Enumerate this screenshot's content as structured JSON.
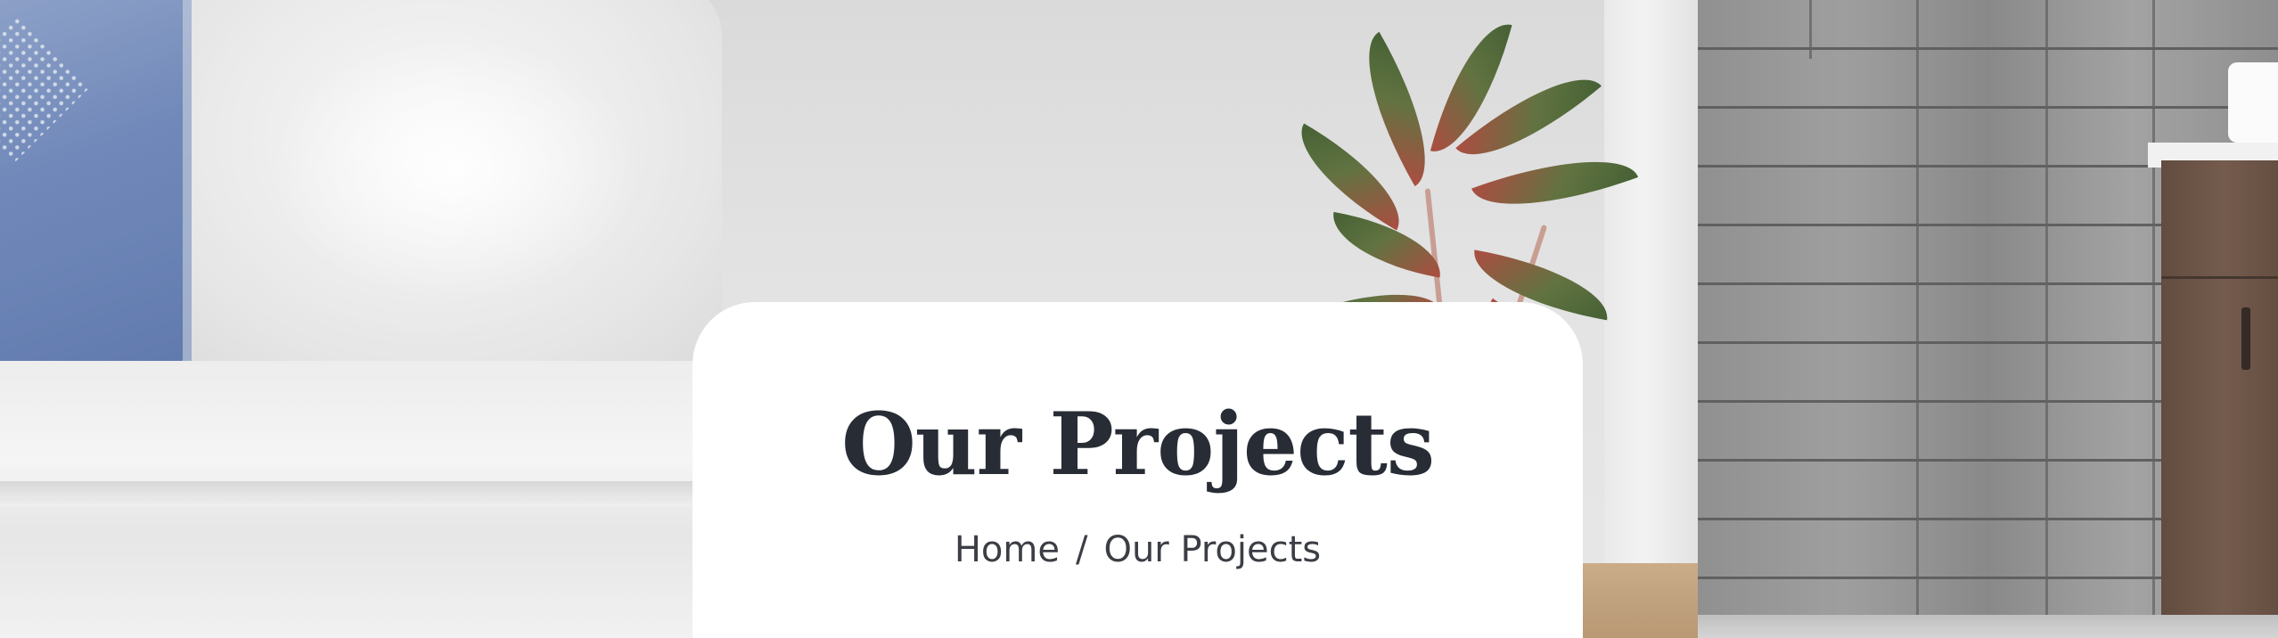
{
  "header": {
    "title": "Our Projects"
  },
  "breadcrumb": {
    "home": "Home",
    "separator": "/",
    "current": "Our Projects"
  },
  "colors": {
    "title_text": "#272c35",
    "breadcrumb_text": "#3b3e45",
    "card_background": "#ffffff"
  },
  "background_image": {
    "icon": "bedroom-hero-photo"
  }
}
